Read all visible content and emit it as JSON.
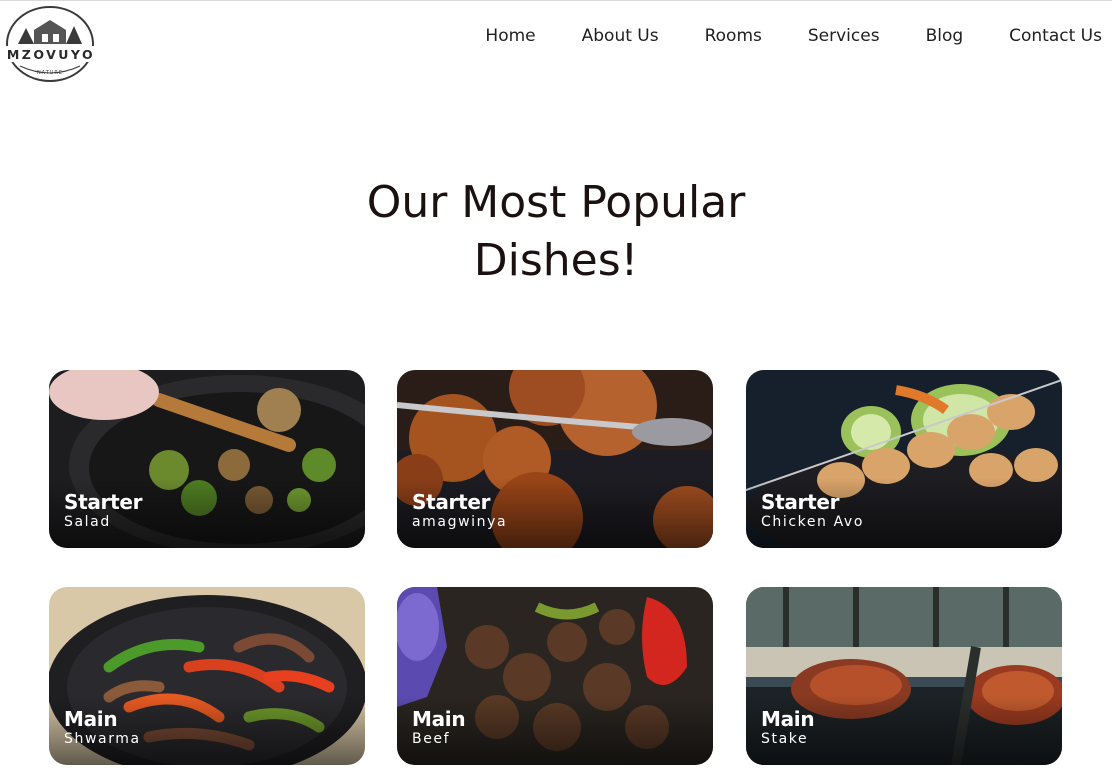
{
  "brand": {
    "logo_text": "MZOVUYO",
    "logo_subtext": "NATURE"
  },
  "nav": {
    "items": [
      "Home",
      "About Us",
      "Rooms",
      "Services",
      "Blog",
      "Contact Us"
    ]
  },
  "section": {
    "title_line1": "Our Most Popular",
    "title_line2": "Dishes!"
  },
  "dishes": [
    {
      "category": "Starter",
      "name": "Salad",
      "image": "stir-fry-pan"
    },
    {
      "category": "Starter",
      "name": "amagwinya",
      "image": "fried-dough"
    },
    {
      "category": "Starter",
      "name": "Chicken Avo",
      "image": "chicken-skewers"
    },
    {
      "category": "Main",
      "name": "Shwarma",
      "image": "pepper-beef-skillet"
    },
    {
      "category": "Main",
      "name": "Beef",
      "image": "beef-stir-fry"
    },
    {
      "category": "Main",
      "name": "Stake",
      "image": "grilled-steak"
    }
  ]
}
